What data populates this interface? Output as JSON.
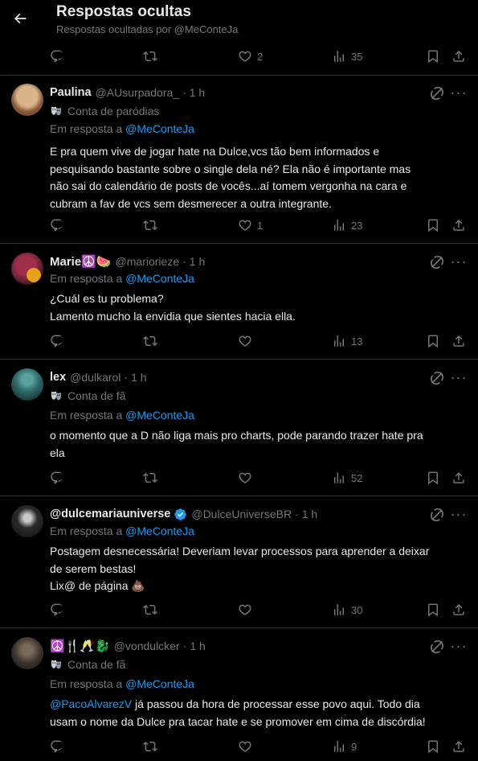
{
  "header": {
    "title": "Respostas ocultas",
    "subtitle": "Respostas ocultadas por @MeConteJa"
  },
  "top_actions": {
    "likes": "2",
    "views": "35"
  },
  "tweets": [
    {
      "name": "Paulina",
      "handle": "@AUsurpadora_",
      "time": "1 h",
      "badge": "Conta de paródias",
      "reply_prefix": "Em resposta a",
      "reply_to": "@MeConteJa",
      "body_lines": [
        "E pra quem vive de jogar hate na Dulce,vcs tão bem informados e",
        "pesquisando bastante sobre o single dela né? Ela não é importante mas",
        "não sai do calendário de posts de vocês...aí tomem vergonha na cara e",
        "cubram a fav de vcs sem desmerecer a outra integrante."
      ],
      "likes": "1",
      "views": "23"
    },
    {
      "name": "Marie☮️🍉",
      "handle": "@mariorieze",
      "time": "1 h",
      "reply_prefix": "Em resposta a",
      "reply_to": "@MeConteJa",
      "body_lines": [
        "¿Cuál es tu problema?",
        "Lamento mucho la envidia que sientes hacia ella."
      ],
      "views": "13"
    },
    {
      "name": "lex",
      "handle": "@dulkarol",
      "time": "1 h",
      "badge": "Conta de fã",
      "reply_prefix": "Em resposta a",
      "reply_to": "@MeConteJa",
      "body_lines": [
        "o momento que a D não liga mais pro charts, pode parando trazer hate pra",
        "ela"
      ],
      "views": "52"
    },
    {
      "name": "@dulcemariauniverse",
      "handle": "@DulceUniverseBR",
      "time": "1 h",
      "reply_prefix": "Em resposta a",
      "reply_to": "@MeConteJa",
      "body_lines": [
        "Postagem desnecessária! Deveriam levar processos para aprender a deixar",
        "de serem bestas!",
        "Lix@ de página 💩"
      ],
      "views": "30"
    },
    {
      "name": "☮️🍴🥂🐉",
      "handle": "@vondulcker",
      "time": "1 h",
      "badge": "Conta de fã",
      "reply_prefix": "Em resposta a",
      "reply_to": "@MeConteJa",
      "body_mention": "@PacoAlvarezV",
      "body_lines": [
        " já passou da hora de processar esse povo aqui. Todo dia",
        "usam o nome da Dulce pra tacar hate e se promover em cima de discórdia!"
      ],
      "views": "9"
    }
  ],
  "colors": {
    "background": "#000000",
    "text": "#e7e9ea",
    "muted": "#71767b",
    "link": "#1d9bf0",
    "separator": "#2f3336",
    "verified": "#1d9bf0"
  },
  "icons": [
    "back-arrow-icon",
    "reply-icon",
    "retweet-icon",
    "heart-icon",
    "views-icon",
    "bookmark-icon",
    "share-icon",
    "grok-icon",
    "more-icon",
    "mask-icon",
    "verified-icon"
  ]
}
